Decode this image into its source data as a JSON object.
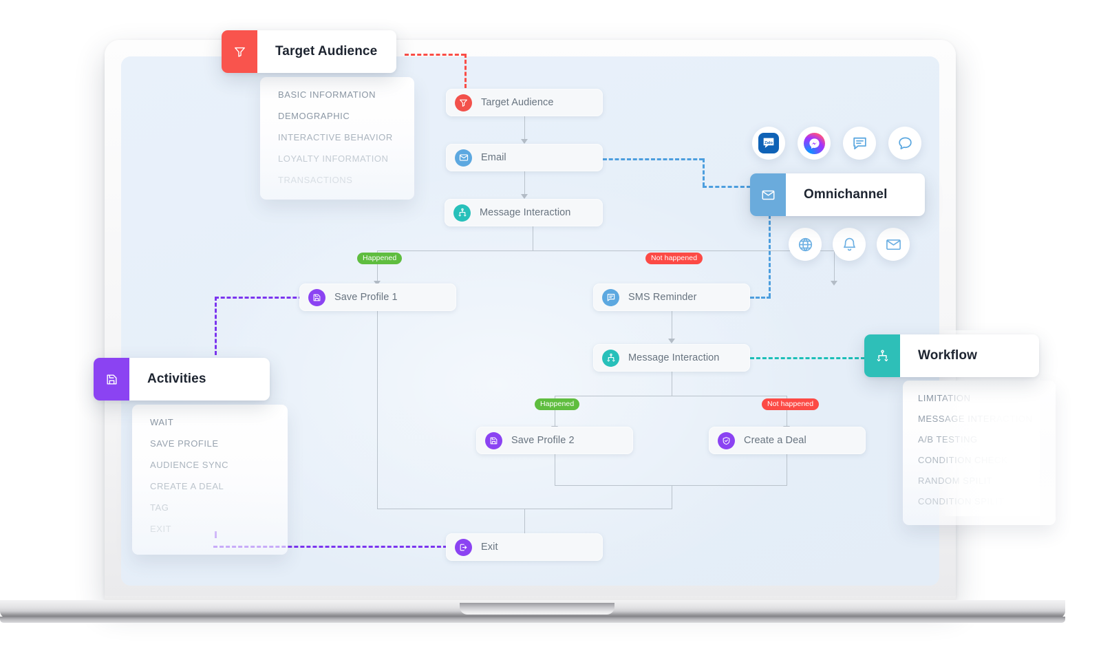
{
  "device": {
    "name": "laptop-mockup"
  },
  "flow": {
    "nodes": [
      {
        "id": "target_audience",
        "label": "Target Audience",
        "icon": "funnel-icon",
        "color": "#f2514b"
      },
      {
        "id": "email",
        "label": "Email",
        "icon": "envelope-icon",
        "color": "#5ca8e0"
      },
      {
        "id": "message_interaction_1",
        "label": "Message Interaction",
        "icon": "split-icon",
        "color": "#27c0ba"
      },
      {
        "id": "save_profile_1",
        "label": "Save Profile 1",
        "icon": "save-icon",
        "color": "#8b43f2"
      },
      {
        "id": "sms_reminder",
        "label": "SMS Reminder",
        "icon": "sms-icon",
        "color": "#5ca8e0"
      },
      {
        "id": "message_interaction_2",
        "label": "Message Interaction",
        "icon": "split-icon",
        "color": "#27c0ba"
      },
      {
        "id": "save_profile_2",
        "label": "Save Profile 2",
        "icon": "save-icon",
        "color": "#8b43f2"
      },
      {
        "id": "create_a_deal",
        "label": "Create a Deal",
        "icon": "deal-icon",
        "color": "#8b43f2"
      },
      {
        "id": "exit",
        "label": "Exit",
        "icon": "exit-icon",
        "color": "#8b43f2"
      }
    ],
    "badges": [
      {
        "id": "b1",
        "label": "Happened",
        "color": "#5fbd3f"
      },
      {
        "id": "b2",
        "label": "Not happened",
        "color": "#fc4a45"
      },
      {
        "id": "b3",
        "label": "Happened",
        "color": "#5fbd3f"
      },
      {
        "id": "b4",
        "label": "Not happened",
        "color": "#fc4a45"
      }
    ]
  },
  "panels": {
    "target_audience": {
      "title": "Target Audience",
      "tab_icon": "funnel-icon",
      "tab_color": "#f9544d",
      "items": [
        "BASIC INFORMATION",
        "DEMOGRAPHIC",
        "INTERACTIVE BEHAVIOR",
        "LOYALTY INFORMATION",
        "TRANSACTIONS"
      ]
    },
    "activities": {
      "title": "Activities",
      "tab_icon": "save-icon",
      "tab_color": "#8b43f2",
      "items": [
        "WAIT",
        "SAVE PROFILE",
        "AUDIENCE SYNC",
        "CREATE A DEAL",
        "TAG",
        "EXIT"
      ]
    },
    "omnichannel": {
      "title": "Omnichannel",
      "tab_icon": "envelope-icon",
      "tab_color": "#6aabdc",
      "channels_top": [
        "zalo-icon",
        "messenger-icon",
        "chat-bubble-lines-icon",
        "chat-bubble-icon"
      ],
      "channels_bottom": [
        "globe-icon",
        "bell-icon",
        "envelope-icon"
      ]
    },
    "workflow": {
      "title": "Workflow",
      "tab_icon": "split-icon",
      "tab_color": "#2ebfb8",
      "items": [
        "LIMITATION",
        "MESSAGE INTERACTION",
        "A/B TESTING",
        "CONDITION CHECK",
        "RANDOM SPILIT",
        "CONDITION SPILIT"
      ]
    }
  },
  "colors": {
    "red": "#f9544d",
    "blue": "#5ca8e0",
    "teal": "#2ebfb8",
    "purple": "#8b43f2",
    "green": "#5fbd3f",
    "screen_bg": "#e8f1fa",
    "node_bg": "#f6f8fa",
    "connector": "#b9c2cb"
  }
}
